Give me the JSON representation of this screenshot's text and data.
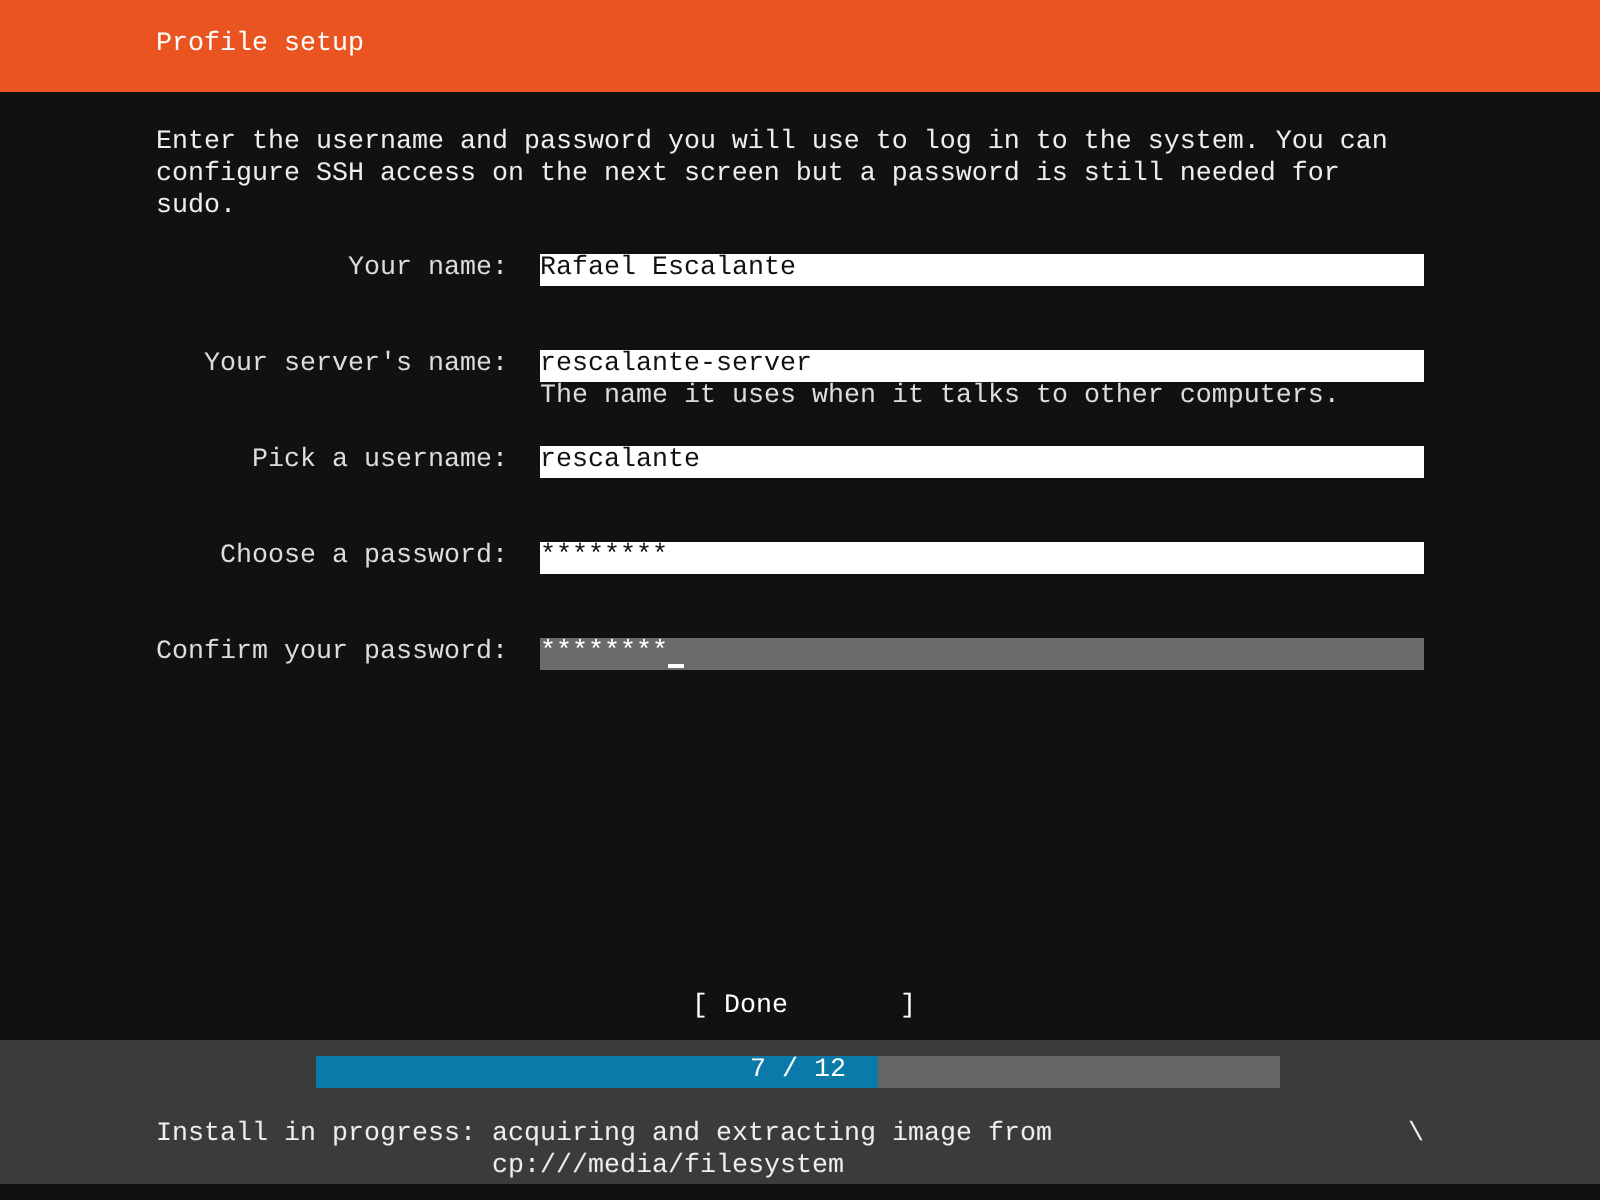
{
  "header": {
    "title": "Profile setup"
  },
  "intro": "Enter the username and password you will use to log in to the system. You can configure SSH access on the next screen but a password is still needed for sudo.",
  "fields": [
    {
      "label": "Your name:",
      "value": "Rafael Escalante",
      "focused": false
    },
    {
      "label": "Your server's name:",
      "value": "rescalante-server",
      "hint": "The name it uses when it talks to other computers.",
      "focused": false
    },
    {
      "label": "Pick a username:",
      "value": "rescalante",
      "focused": false
    },
    {
      "label": "Choose a password:",
      "value": "********",
      "focused": false
    },
    {
      "label": "Confirm your password:",
      "value": "********",
      "focused": true
    }
  ],
  "done_button": "[ Done       ]",
  "progress": {
    "label": "7 / 12",
    "level": 0.583
  },
  "status": {
    "label": "Install in progress:",
    "message": "acquiring and extracting image from cp:///media/filesystem",
    "spinner": "\\"
  }
}
